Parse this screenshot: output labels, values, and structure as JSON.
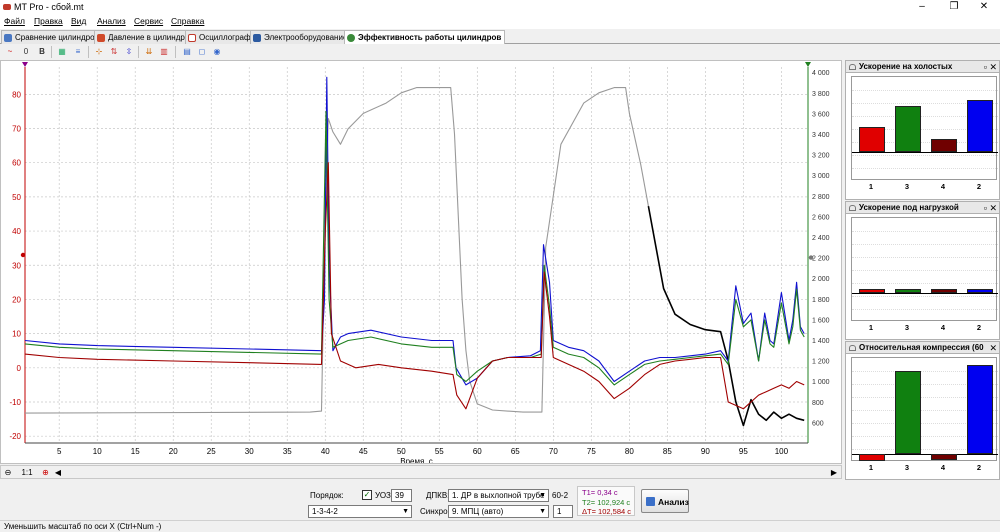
{
  "window": {
    "title": "MT Pro - сбой.mt",
    "minimize": "–",
    "maximize": "❐",
    "close": "✕"
  },
  "menu": [
    "Файл",
    "Правка",
    "Вид",
    "Анализ",
    "Сервис",
    "Справка"
  ],
  "tabs": [
    {
      "label": "Сравнение цилиндров",
      "icon": "cylinders-icon",
      "color": "#4a78c2"
    },
    {
      "label": "Давление в цилиндре",
      "icon": "pressure-icon",
      "color": "#d04a2a"
    },
    {
      "label": "Осциллограф",
      "icon": "oscilloscope-icon",
      "color": "#c0392b"
    },
    {
      "label": "Электрооборудование",
      "icon": "electrical-icon",
      "color": "#2c5aa0"
    },
    {
      "label": "Эффективность работы цилиндров",
      "icon": "efficiency-icon",
      "color": "#3a8a3a"
    }
  ],
  "toolbar": [
    "~",
    "0",
    "B",
    "▦",
    "≡",
    "⊹",
    "⇅",
    "⇳",
    "⇊",
    "▥",
    "▤",
    "◻",
    "◉"
  ],
  "chart_data": {
    "type": "line",
    "xlabel": "Время, с",
    "xlim": [
      0.5,
      103.5
    ],
    "xticks": [
      5,
      10,
      15,
      20,
      25,
      30,
      35,
      40,
      45,
      50,
      55,
      60,
      65,
      70,
      75,
      80,
      85,
      90,
      95,
      100
    ],
    "ylim_left": [
      -22,
      88
    ],
    "yticks_left": [
      -20,
      -10,
      0,
      10,
      20,
      30,
      40,
      50,
      60,
      70,
      80
    ],
    "ylim_right": [
      400,
      4050
    ],
    "yticks_right": [
      600,
      800,
      1000,
      1200,
      1400,
      1600,
      1800,
      2000,
      2200,
      2400,
      2600,
      2800,
      3000,
      3200,
      3400,
      3600,
      3800,
      4000
    ],
    "yticks_right_labels": [
      "600",
      "800",
      "1 000",
      "1 200",
      "1 400",
      "1 600",
      "1 800",
      "2 000",
      "2 200",
      "2 400",
      "2 600",
      "2 800",
      "3 000",
      "3 200",
      "3 400",
      "3 600",
      "3 800",
      "4 000"
    ],
    "left_axis_color": "#c00000",
    "right_axis_color": "#208020",
    "series": [
      {
        "color": "#999999",
        "axis": "right",
        "points": [
          [
            0.5,
            690
          ],
          [
            38,
            700
          ],
          [
            39.5,
            710
          ],
          [
            40,
            2700
          ],
          [
            40.4,
            3550
          ],
          [
            41,
            3420
          ],
          [
            42,
            3300
          ],
          [
            43,
            3450
          ],
          [
            45,
            3600
          ],
          [
            48,
            3700
          ],
          [
            50,
            3800
          ],
          [
            52,
            3850
          ],
          [
            56.5,
            3850
          ],
          [
            57,
            3400
          ],
          [
            58,
            1800
          ],
          [
            58.5,
            1300
          ],
          [
            59,
            1000
          ],
          [
            60,
            780
          ],
          [
            62,
            720
          ],
          [
            66,
            700
          ],
          [
            68.5,
            700
          ],
          [
            69,
            2300
          ],
          [
            71,
            3300
          ],
          [
            74,
            3700
          ],
          [
            76,
            3800
          ],
          [
            78,
            3850
          ],
          [
            79.5,
            3850
          ],
          [
            80,
            3600
          ],
          [
            81.5,
            3100
          ],
          [
            82.5,
            2700
          ]
        ]
      },
      {
        "color": "#000000",
        "axis": "right",
        "points": [
          [
            82.5,
            2700
          ],
          [
            83.5,
            2300
          ],
          [
            84.5,
            1900
          ],
          [
            86,
            1650
          ],
          [
            88,
            1550
          ],
          [
            90,
            1500
          ],
          [
            92,
            1480
          ],
          [
            93,
            1200
          ],
          [
            94,
            800
          ],
          [
            95,
            570
          ],
          [
            96,
            820
          ],
          [
            97,
            680
          ],
          [
            98,
            620
          ],
          [
            99,
            700
          ],
          [
            100,
            640
          ],
          [
            101,
            680
          ],
          [
            102,
            640
          ],
          [
            103,
            620
          ]
        ]
      },
      {
        "color": "#1010d0",
        "axis": "left",
        "points": [
          [
            0.5,
            8
          ],
          [
            5,
            7
          ],
          [
            10,
            6.5
          ],
          [
            20,
            6
          ],
          [
            30,
            5.5
          ],
          [
            39.5,
            5
          ],
          [
            39.9,
            20
          ],
          [
            40.2,
            85
          ],
          [
            40.5,
            30
          ],
          [
            41,
            5
          ],
          [
            42,
            9
          ],
          [
            43,
            10
          ],
          [
            46,
            11
          ],
          [
            50,
            9
          ],
          [
            54,
            8
          ],
          [
            56.8,
            8
          ],
          [
            57.2,
            0
          ],
          [
            58.5,
            -5
          ],
          [
            60,
            -3
          ],
          [
            62,
            2
          ],
          [
            64,
            3
          ],
          [
            67,
            3.5
          ],
          [
            68.3,
            5
          ],
          [
            68.7,
            36
          ],
          [
            69.5,
            25
          ],
          [
            70,
            8
          ],
          [
            72,
            6
          ],
          [
            74,
            5
          ],
          [
            76,
            2
          ],
          [
            78,
            -4
          ],
          [
            80,
            -1
          ],
          [
            82,
            2
          ],
          [
            84,
            3
          ],
          [
            86,
            3
          ],
          [
            88,
            3.5
          ],
          [
            90,
            4
          ],
          [
            92,
            5
          ],
          [
            93,
            2
          ],
          [
            94,
            24
          ],
          [
            95,
            13
          ],
          [
            96,
            16
          ],
          [
            97,
            2
          ],
          [
            97.8,
            16
          ],
          [
            98.5,
            8
          ],
          [
            99,
            7
          ],
          [
            100,
            22
          ],
          [
            101,
            8
          ],
          [
            101.5,
            14
          ],
          [
            102,
            25
          ],
          [
            102.5,
            12
          ],
          [
            103,
            10
          ]
        ]
      },
      {
        "color": "#208020",
        "axis": "left",
        "points": [
          [
            0.5,
            7
          ],
          [
            5,
            6
          ],
          [
            10,
            5.5
          ],
          [
            20,
            5
          ],
          [
            30,
            4.5
          ],
          [
            39.5,
            4
          ],
          [
            40.1,
            75
          ],
          [
            40.5,
            20
          ],
          [
            41,
            6
          ],
          [
            43,
            8
          ],
          [
            46,
            9
          ],
          [
            50,
            7
          ],
          [
            54,
            6
          ],
          [
            56.8,
            6
          ],
          [
            57.3,
            -2
          ],
          [
            58.5,
            -4
          ],
          [
            60,
            -1
          ],
          [
            62,
            2
          ],
          [
            64,
            3
          ],
          [
            67,
            3
          ],
          [
            68.4,
            4
          ],
          [
            68.8,
            30
          ],
          [
            69.5,
            18
          ],
          [
            70,
            6
          ],
          [
            72,
            4
          ],
          [
            74,
            3
          ],
          [
            76,
            0
          ],
          [
            78,
            -5
          ],
          [
            80,
            -2
          ],
          [
            82,
            1
          ],
          [
            84,
            2
          ],
          [
            86,
            2.5
          ],
          [
            88,
            3
          ],
          [
            90,
            3.5
          ],
          [
            92,
            4
          ],
          [
            93,
            1
          ],
          [
            94,
            20
          ],
          [
            95,
            12
          ],
          [
            96,
            14
          ],
          [
            97,
            2
          ],
          [
            97.8,
            14
          ],
          [
            98.5,
            7
          ],
          [
            99,
            6
          ],
          [
            100,
            19
          ],
          [
            101,
            7
          ],
          [
            101.5,
            12
          ],
          [
            102,
            23
          ],
          [
            102.5,
            11
          ],
          [
            103,
            9
          ]
        ]
      },
      {
        "color": "#a00000",
        "axis": "left",
        "points": [
          [
            0.5,
            4
          ],
          [
            5,
            3
          ],
          [
            10,
            2.5
          ],
          [
            20,
            2
          ],
          [
            30,
            1.5
          ],
          [
            39.5,
            1
          ],
          [
            40,
            40
          ],
          [
            40.4,
            60
          ],
          [
            40.8,
            10
          ],
          [
            42,
            2
          ],
          [
            44,
            0
          ],
          [
            47,
            1
          ],
          [
            50,
            0
          ],
          [
            54,
            -1
          ],
          [
            56.8,
            -2
          ],
          [
            57.3,
            -8
          ],
          [
            58.5,
            -12
          ],
          [
            60,
            -3
          ],
          [
            62,
            2
          ],
          [
            64,
            3
          ],
          [
            67,
            3
          ],
          [
            68.4,
            3
          ],
          [
            68.8,
            28
          ],
          [
            69.5,
            15
          ],
          [
            70,
            3
          ],
          [
            72,
            1
          ],
          [
            74,
            -1
          ],
          [
            76,
            -4
          ],
          [
            78,
            -9
          ],
          [
            80,
            -6
          ],
          [
            82,
            -2
          ],
          [
            84,
            1
          ],
          [
            86,
            2
          ],
          [
            88,
            2.5
          ],
          [
            90,
            3
          ],
          [
            92,
            3
          ],
          [
            93,
            -10
          ],
          [
            95,
            -12
          ],
          [
            97,
            -8
          ],
          [
            98,
            -7
          ],
          [
            99,
            -6
          ],
          [
            100,
            -5
          ],
          [
            101,
            -6
          ],
          [
            102,
            -4
          ],
          [
            103,
            -5
          ]
        ]
      }
    ]
  },
  "scrollbar": {
    "zoom": "1:1",
    "plus": "⊕",
    "left": "◀",
    "right": "▶",
    "minus": "⊖"
  },
  "controls": {
    "order_label": "Порядок:",
    "order_value": "1-3-4-2",
    "uoz_label": "УОЗ:",
    "uoz_checked": true,
    "uoz_value": "39",
    "dpkv_label": "ДПКВ:",
    "dpkv_value": "1. ДР в выхлопной трубе",
    "dpkv_suffix": "60-2",
    "sync_label": "Синхро:",
    "sync_value": "9. МПЦ (авто)",
    "sync_num": "1",
    "t1": "T1= 0,34 c",
    "t2": "T2= 102,924 c",
    "dt": "ΔT= 102,584 c",
    "t1_color": "#8b008b",
    "t2_color": "#208020",
    "dt_color": "#a00000",
    "analyze_label": "Анализ"
  },
  "status": "Уменьшить масштаб по оси X (Ctrl+Num -)",
  "panels": [
    {
      "title": "Ускорение на холостых",
      "categories": [
        "1",
        "3",
        "4",
        "2"
      ],
      "values": [
        0.4,
        0.73,
        0.21,
        0.83
      ],
      "colors": [
        "#e00000",
        "#108010",
        "#700000",
        "#0000f0"
      ],
      "baseline": 0.0
    },
    {
      "title": "Ускорение под нагрузкой",
      "categories": [
        "1",
        "3",
        "4",
        "2"
      ],
      "values": [
        0.06,
        0.07,
        0.06,
        0.07
      ],
      "colors": [
        "#e00000",
        "#108010",
        "#700000",
        "#0000f0"
      ],
      "baseline": 0.0
    },
    {
      "title": "Относительная компрессия (60",
      "categories": [
        "1",
        "3",
        "4",
        "2"
      ],
      "values": [
        -0.08,
        0.93,
        -0.07,
        1.0
      ],
      "colors": [
        "#e00000",
        "#108010",
        "#700000",
        "#0000f0"
      ],
      "baseline": 0.08
    }
  ]
}
